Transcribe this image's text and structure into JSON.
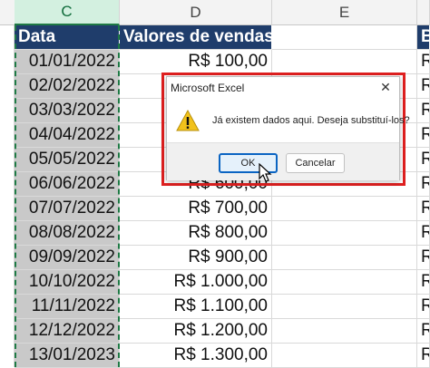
{
  "columns": {
    "c": "C",
    "d": "D",
    "e": "E",
    "f": "F"
  },
  "table": {
    "header_date": "Data",
    "header_sales": "Valores de vendas",
    "header_f": "B",
    "rows": [
      {
        "date": "01/01/2022",
        "value": "R$ 100,00",
        "f": "R"
      },
      {
        "date": "02/02/2022",
        "value": "R$ 200,00",
        "f": "R"
      },
      {
        "date": "03/03/2022",
        "value": "R$ 300,00",
        "f": "R"
      },
      {
        "date": "04/04/2022",
        "value": "R$ 400,00",
        "f": "R"
      },
      {
        "date": "05/05/2022",
        "value": "R$ 500,00",
        "f": "R"
      },
      {
        "date": "06/06/2022",
        "value": "R$ 600,00",
        "f": "R"
      },
      {
        "date": "07/07/2022",
        "value": "R$ 700,00",
        "f": "R"
      },
      {
        "date": "08/08/2022",
        "value": "R$ 800,00",
        "f": "R"
      },
      {
        "date": "09/09/2022",
        "value": "R$ 900,00",
        "f": "R"
      },
      {
        "date": "10/10/2022",
        "value": "R$ 1.000,00",
        "f": "R"
      },
      {
        "date": "11/11/2022",
        "value": "R$ 1.100,00",
        "f": "R"
      },
      {
        "date": "12/12/2022",
        "value": "R$ 1.200,00",
        "f": "R"
      },
      {
        "date": "13/01/2023",
        "value": "R$ 1.300,00",
        "f": "R"
      }
    ]
  },
  "dialog": {
    "title": "Microsoft Excel",
    "close": "✕",
    "message": "Já existem dados aqui. Deseja substituí-los?",
    "ok_label": "OK",
    "cancel_label": "Cancelar",
    "icon": "warning-icon"
  },
  "colors": {
    "header_bg": "#1f3d6b",
    "selected_col": "#c9c9c9",
    "highlight": "#e02020",
    "ok_border": "#0a64c2"
  }
}
